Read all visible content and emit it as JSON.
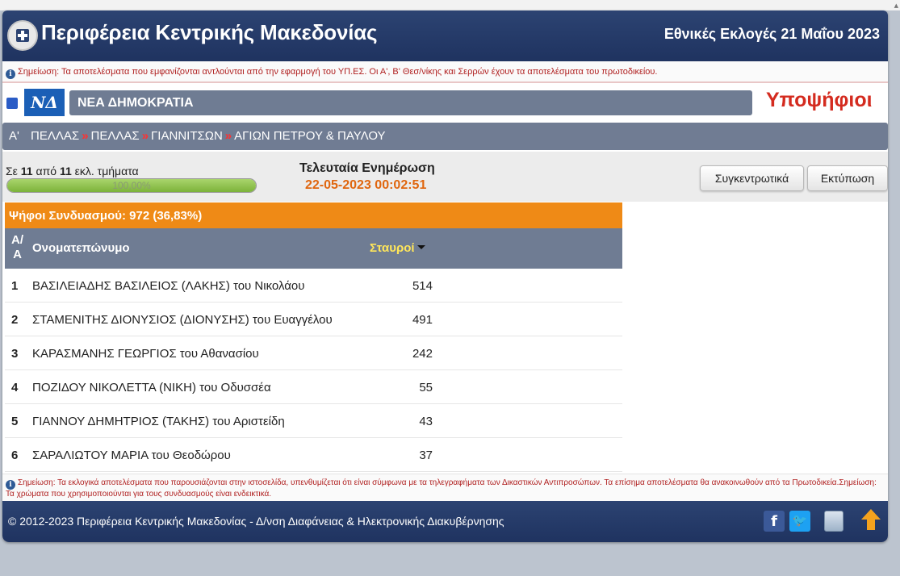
{
  "header": {
    "site_title": "Περιφέρεια Κεντρικής Μακεδονίας",
    "election_title": "Εθνικές Εκλογές 21 Μαΐου 2023"
  },
  "notice": {
    "text": "Σημείωση: Τα αποτελέσματα που εμφανίζονται αντλούνται από την εφαρμογή του ΥΠ.ΕΣ. Οι Α', Β' Θεσ/νίκης και Σερρών έχουν τα αποτελέσματα του πρωτοδικείου."
  },
  "party": {
    "logo_text": "ΝΔ",
    "name": "ΝΕΑ ΔΗΜΟΚΡΑΤΙΑ",
    "section_title": "Υποψήφιοι"
  },
  "breadcrumb": {
    "level": "Α'",
    "items": [
      "ΠΕΛΛΑΣ",
      "ΠΕΛΛΑΣ",
      "ΓΙΑΝΝΙΤΣΩΝ",
      "ΑΓΙΩΝ ΠΕΤΡΟΥ & ΠΑΥΛΟΥ"
    ],
    "separator": "»"
  },
  "stats": {
    "prefix": "Σε",
    "counted": "11",
    "of": "από",
    "total": "11",
    "suffix": "εκλ. τμήματα",
    "progress_label": "100,00%",
    "progress_fraction": 1.0,
    "last_update_label": "Τελευταία Ενημέρωση",
    "last_update_value": "22-05-2023 00:02:51"
  },
  "buttons": {
    "summary": "Συγκεντρωτικά",
    "print": "Εκτύπωση"
  },
  "votes_bar": {
    "text": "Ψήφοι Συνδυασμού: 972 (36,83%)"
  },
  "table": {
    "col_num_line1": "Α/",
    "col_num_line2": "Α",
    "col_name": "Ονοματεπώνυμο",
    "col_votes": "Σταυροί",
    "rows": [
      {
        "num": "1",
        "name": "ΒΑΣΙΛΕΙΑΔΗΣ ΒΑΣΙΛΕΙΟΣ (ΛΑΚΗΣ) του Νικολάου",
        "votes": "514"
      },
      {
        "num": "2",
        "name": "ΣΤΑΜΕΝΙΤΗΣ ΔΙΟΝΥΣΙΟΣ (ΔΙΟΝΥΣΗΣ) του Ευαγγέλου",
        "votes": "491"
      },
      {
        "num": "3",
        "name": "ΚΑΡΑΣΜΑΝΗΣ ΓΕΩΡΓΙΟΣ του Αθανασίου",
        "votes": "242"
      },
      {
        "num": "4",
        "name": "ΠΟΖΙΔΟΥ ΝΙΚΟΛΕΤΤΑ (ΝΙΚΗ) του Οδυσσέα",
        "votes": "55"
      },
      {
        "num": "5",
        "name": "ΓΙΑΝΝΟΥ ΔΗΜΗΤΡΙΟΣ (ΤΑΚΗΣ) του Αριστείδη",
        "votes": "43"
      },
      {
        "num": "6",
        "name": "ΣΑΡΑΛΙΩΤΟΥ ΜΑΡΙΑ του Θεοδώρου",
        "votes": "37"
      }
    ]
  },
  "footer_note": {
    "text": "Σημείωση: Τα εκλογικά αποτελέσματα που παρουσιάζονται στην ιστοσελίδα, υπενθυμίζεται ότι είναι σύμφωνα με τα τηλεγραφήματα των Δικαστικών Αντιπροσώπων. Τα επίσημα αποτελέσματα θα ανακοινωθούν από τα Πρωτοδικεία.Σημείωση: Τα χρώματα που χρησιμοποιούνται για τους συνδυασμούς είναι ενδεικτικά."
  },
  "footer": {
    "copyright": "© 2012-2023 Περιφέρεια Κεντρικής Μακεδονίας - Δ/νση Διαφάνειας & Ηλεκτρονικής Διακυβέρνησης",
    "icons": [
      "facebook-icon",
      "twitter-icon",
      "book-icon",
      "scroll-top-icon"
    ]
  },
  "colors": {
    "header_bg": "#2c4372",
    "accent_orange": "#ef8a16",
    "party_blue": "#1b5fb6",
    "title_red": "#d42b1f",
    "table_header_bg": "#6f7c93"
  }
}
